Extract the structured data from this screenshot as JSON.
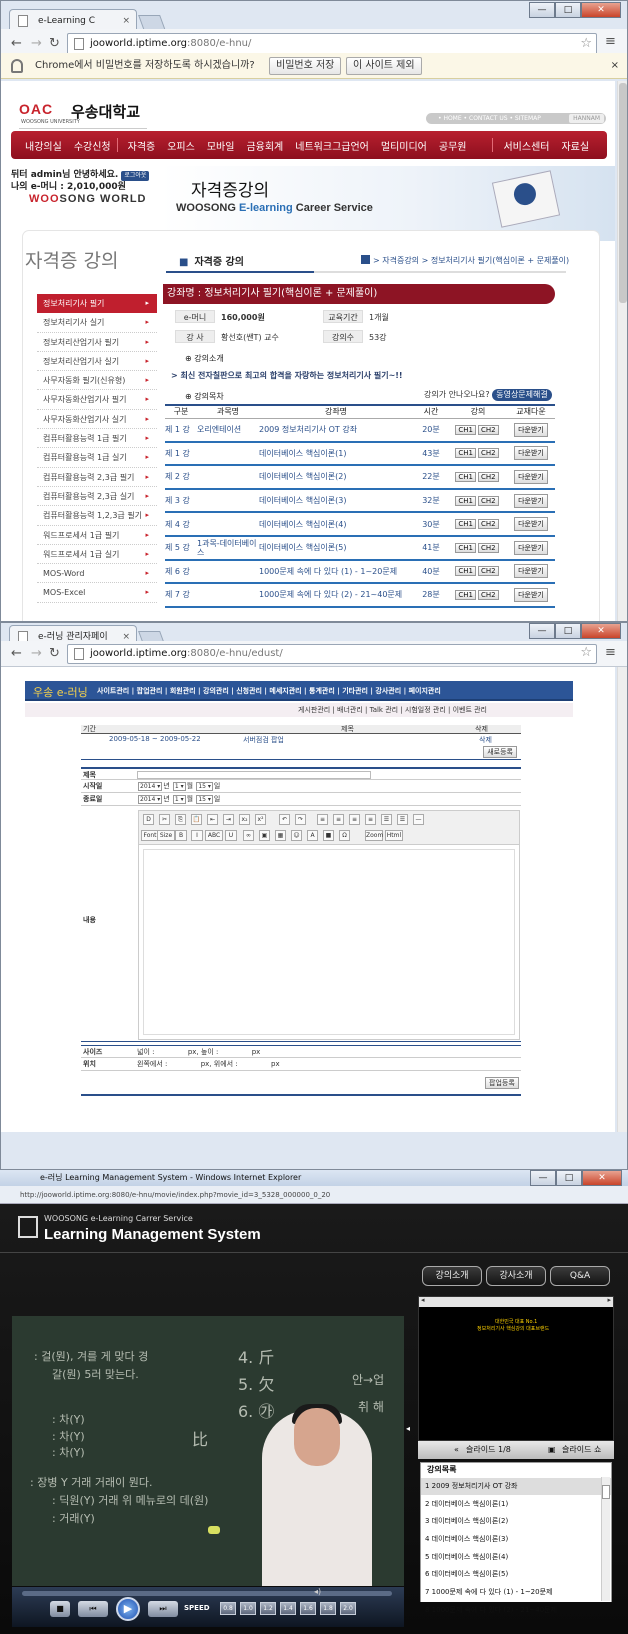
{
  "win1": {
    "tab_title": "e-Learning C",
    "url_host": "jooworld.iptime.org",
    "url_rest": ":8080/e-hnu/",
    "infobar_text": "Chrome에서 비밀번호를 저장하도록 하시겠습니까?",
    "save_pw_button": "비밀번호 저장",
    "never_button": "이 사이트 제외",
    "close_x": "×"
  },
  "site1": {
    "univ_mark": "OAC",
    "univ_name": "우송대학교",
    "univ_sub": "WOOSONG UNIVERSITY",
    "top_links": "• HOME  • CONTACT US  • SITEMAP",
    "top_links_tag": "HANNAM",
    "gnb": [
      "내강의실",
      "수강신청",
      "자격증",
      "오피스",
      "모바일",
      "금융회계",
      "네트워크그급언어",
      "멀티미디어",
      "공무원",
      "서비스센터",
      "자료실"
    ],
    "welcome_line1": "뒤터 admin님 안녕하세요.",
    "logout": "로그아웃",
    "welcome_line2": "나의 e-머니 : 2,010,000원",
    "brand_a": "WOO",
    "brand_b": "SONG WORLD",
    "hero_title": "자격증강의",
    "hero_sub_a": "WOOSONG ",
    "hero_sub_b": "E-learning",
    "hero_sub_c": " Career Service",
    "lnb_title": "자격증 강의",
    "lnb_items": [
      "정보처리기사 필기",
      "정보처리기사 실기",
      "정보처리산업기사 필기",
      "정보처리산업기사 실기",
      "사무자동화 필기(신유형)",
      "사무자동화산업기사 필기",
      "사무자동화산업기사 실기",
      "컴퓨터활용능력 1급 필기",
      "컴퓨터활용능력 1급 실기",
      "컴퓨터활용능력 2,3급 필기",
      "컴퓨터활용능력 2,3급 실기",
      "컴퓨터활용능력 1,2,3급 필기",
      "워드프로세서 1급 필기",
      "워드프로세서 1급 실기",
      "MOS-Word",
      "MOS-Excel"
    ],
    "page_title": "자격증 강의",
    "breadcrumb": "> 자격증강의 > 정보처리기사 필기(핵심이론 + 문제풀이)",
    "course_bar": "강좌명 : 정보처리기사 필기(핵심이론 + 문제풀이)",
    "emoney_label": "e-머니",
    "emoney_value": "160,000원",
    "period_label": "교육기간",
    "period_value": "1개월",
    "teacher_label": "강  사",
    "teacher_value": "황선호(쌘T) 교수",
    "count_label": "강의수",
    "count_value": "53강",
    "intro_label": "강의소개",
    "intro_text": "최신 전자칠판으로 최고의 합격을 자랑하는 정보처리기사 필기~!!",
    "toc_label": "강의목차",
    "guide_text": "강의가 안나오나요?",
    "guide_button": "동영상문제해결",
    "table_headers": [
      "구분",
      "과목명",
      "강좌명",
      "시간",
      "강의",
      "교재다운"
    ],
    "rows": [
      {
        "no": "제 1 강",
        "subject": "오리엔테이션",
        "title": "2009 정보처리기사 OT 강좌",
        "time": "20분"
      },
      {
        "no": "제 1 강",
        "subject": "",
        "title": "데이터베이스 핵심이론(1)",
        "time": "43분"
      },
      {
        "no": "제 2 강",
        "subject": "",
        "title": "데이터베이스 핵심이론(2)",
        "time": "22분"
      },
      {
        "no": "제 3 강",
        "subject": "",
        "title": "데이터베이스 핵심이론(3)",
        "time": "32분"
      },
      {
        "no": "제 4 강",
        "subject": "",
        "title": "데이터베이스 핵심이론(4)",
        "time": "30분"
      },
      {
        "no": "제 5 강",
        "subject": "1과목-데이터베이스",
        "title": "데이터베이스 핵심이론(5)",
        "time": "41분"
      },
      {
        "no": "제 6 강",
        "subject": "",
        "title": "1000문제 속에 다 있다 (1) - 1~20문제",
        "time": "40분"
      },
      {
        "no": "제 7 강",
        "subject": "",
        "title": "1000문제 속에 다 있다 (2) - 21~40문제",
        "time": "28분"
      }
    ],
    "ch1": "CH1",
    "ch2": "CH2",
    "download": "다운받기"
  },
  "win2": {
    "tab_title": "e-러닝 관리자페이",
    "url_host": "jooworld.iptime.org",
    "url_rest": ":8080/e-hnu/edust/",
    "logo": "우송 e-러닝",
    "menu": "사이트관리  |  팝업관리  |  회원관리  |  강의관리  |  신청관리  |  메세지관리  |  통계관리  |  기타관리  |  강사관리  |  페이지관리",
    "submenu": "게시판관리 | 배너관리 | Talk 관리 | 시험일정 관리 | 이벤트 관리",
    "col_period": "기간",
    "col_subject": "제목",
    "col_delete": "삭제",
    "popup_period": "2009-05-18 ~ 2009-05-22",
    "popup_title": "서버점검 팝업",
    "popup_delete": "삭제",
    "new_button": "새로등록",
    "f_title": "제목",
    "f_start": "시작일",
    "f_end": "종료일",
    "year": "2014",
    "month": "1",
    "day": "15",
    "unit_year": "년",
    "unit_month": "월",
    "unit_day": "일",
    "f_content": "내용",
    "f_size": "사이즈",
    "size_text": "넓이 :               px, 높이 :               px",
    "f_pos": "위치",
    "pos_text": "왼쪽에서 :               px, 위에서 :               px",
    "submit": "팝업등록",
    "editor_row2": [
      "Font",
      "Size",
      "B",
      "I",
      "ABC",
      "U",
      "Zoom",
      "Html"
    ]
  },
  "win3": {
    "title": "e-러닝 Learning Management System - Windows Internet Explorer",
    "url": "http://jooworld.iptime.org:8080/e-hnu/movie/index.php?movie_id=3_5328_000000_0_20",
    "brand_small": "WOOSONG e-Learning Carrer Service",
    "brand_big": "Learning Management System",
    "tabs": [
      "강의소개",
      "강사소개",
      "Q&A"
    ],
    "slide_text1": "대한민국 대표 No.1",
    "slide_text2": "정보처리기사 핵심강의 대표브랜드",
    "slide_label": "슬라이드 1/8",
    "slide_toggle": "슬라이드 쇼",
    "list_title": "강의목록",
    "list": [
      "1  2009 정보처리기사 OT 강좌",
      "2  데이터베이스 핵심이론(1)",
      "3  데이터베이스 핵심이론(2)",
      "4  데이터베이스 핵심이론(3)",
      "5  데이터베이스 핵심이론(4)",
      "6  데이터베이스 핵심이론(5)",
      "7  1000문제 속에 다 있다 (1) - 1~20문제",
      "8  1000문제 속에 다 있다 (2) - 21~40문제"
    ],
    "speed_label": "SPEED",
    "speeds": [
      "0.8",
      "1.0",
      "1.2",
      "1.4",
      "1.6",
      "1.8",
      "2.0"
    ]
  }
}
